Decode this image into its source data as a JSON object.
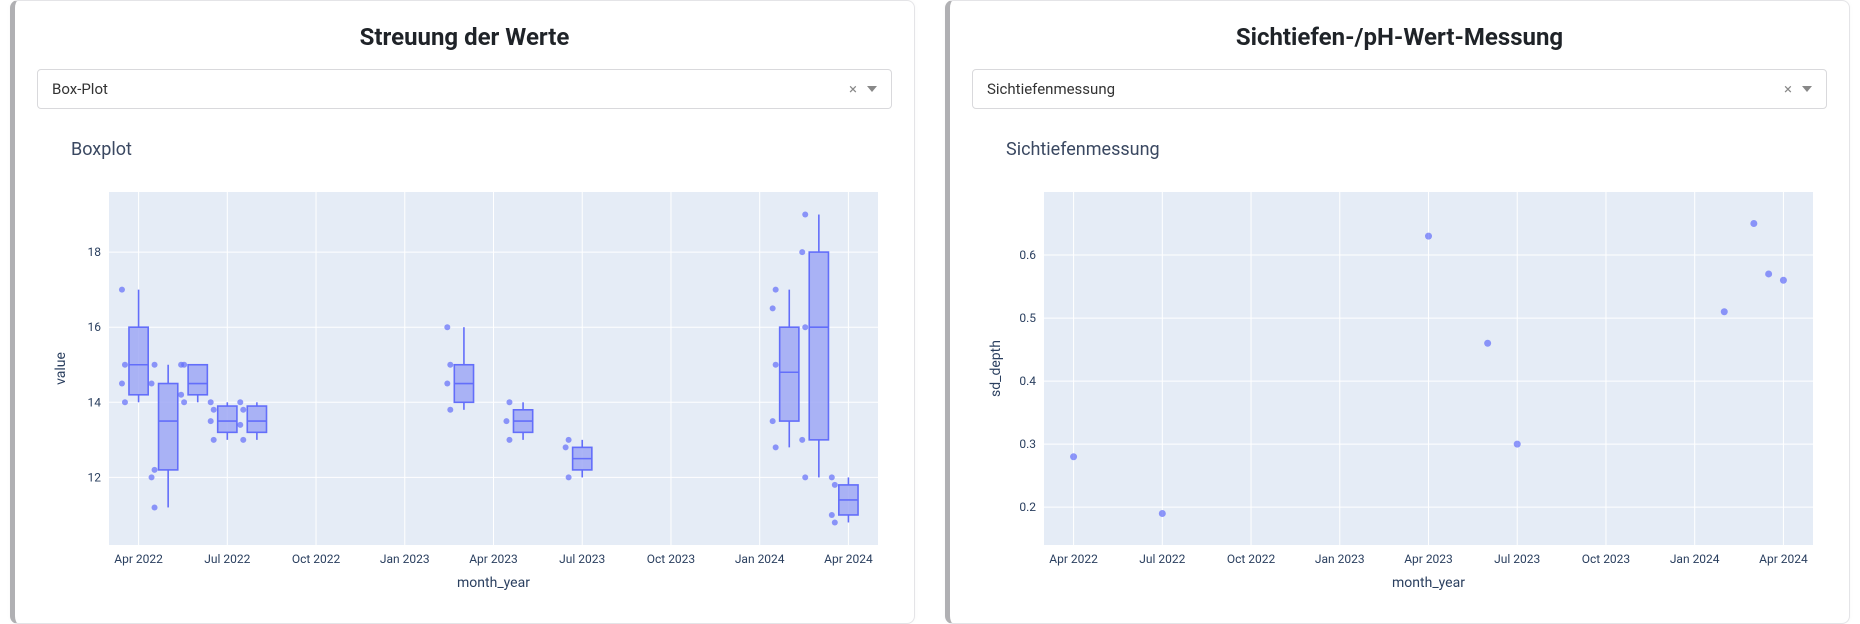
{
  "cards": [
    {
      "title": "Streuung der Werte",
      "select": "Box-Plot",
      "chart_title": "Boxplot"
    },
    {
      "title": "Sichtiefen-/pH-Wert-Messung",
      "select": "Sichtiefenmessung",
      "chart_title": "Sichtiefenmessung"
    }
  ],
  "chart_data": [
    {
      "type": "box",
      "title": "Boxplot",
      "xlabel": "month_year",
      "ylabel": "value",
      "ylim": [
        10.2,
        19.6
      ],
      "yticks": [
        12,
        14,
        16,
        18
      ],
      "x_ticks_labels": [
        "Apr 2022",
        "Jul 2022",
        "Oct 2022",
        "Jan 2023",
        "Apr 2023",
        "Jul 2023",
        "Oct 2023",
        "Jan 2024",
        "Apr 2024"
      ],
      "x_tick_positions": [
        0,
        3,
        6,
        9,
        12,
        15,
        18,
        21,
        24
      ],
      "x_range": [
        -1,
        25
      ],
      "series": [
        {
          "x": 0,
          "min": 14.0,
          "q1": 14.2,
          "median": 15.0,
          "q3": 16.0,
          "max": 17.0,
          "points": [
            14.0,
            14.5,
            15.0,
            17.0
          ]
        },
        {
          "x": 1,
          "min": 11.2,
          "q1": 12.2,
          "median": 13.5,
          "q3": 14.5,
          "max": 15.0,
          "points": [
            11.2,
            12.0,
            12.2,
            14.5,
            15.0
          ]
        },
        {
          "x": 2,
          "min": 14.0,
          "q1": 14.2,
          "median": 14.5,
          "q3": 15.0,
          "max": 15.0,
          "points": [
            14.0,
            14.2,
            15.0,
            15.0
          ]
        },
        {
          "x": 3,
          "min": 13.0,
          "q1": 13.2,
          "median": 13.5,
          "q3": 13.9,
          "max": 14.0,
          "points": [
            13.0,
            13.5,
            13.8,
            14.0
          ]
        },
        {
          "x": 4,
          "min": 13.0,
          "q1": 13.2,
          "median": 13.5,
          "q3": 13.9,
          "max": 14.0,
          "points": [
            13.0,
            13.4,
            13.8,
            14.0
          ]
        },
        {
          "x": 11,
          "min": 13.8,
          "q1": 14.0,
          "median": 14.5,
          "q3": 15.0,
          "max": 16.0,
          "points": [
            13.8,
            14.5,
            15.0,
            16.0
          ]
        },
        {
          "x": 13,
          "min": 13.0,
          "q1": 13.2,
          "median": 13.5,
          "q3": 13.8,
          "max": 14.0,
          "points": [
            13.0,
            13.5,
            14.0
          ]
        },
        {
          "x": 15,
          "min": 12.0,
          "q1": 12.2,
          "median": 12.5,
          "q3": 12.8,
          "max": 13.0,
          "points": [
            12.0,
            12.8,
            13.0
          ]
        },
        {
          "x": 22,
          "min": 12.8,
          "q1": 13.5,
          "median": 14.8,
          "q3": 16.0,
          "max": 17.0,
          "points": [
            12.8,
            13.5,
            15.0,
            16.5,
            17.0
          ]
        },
        {
          "x": 23,
          "min": 12.0,
          "q1": 13.0,
          "median": 16.0,
          "q3": 18.0,
          "max": 19.0,
          "points": [
            12.0,
            13.0,
            16.0,
            18.0,
            19.0
          ]
        },
        {
          "x": 24,
          "min": 10.8,
          "q1": 11.0,
          "median": 11.4,
          "q3": 11.8,
          "max": 12.0,
          "points": [
            10.8,
            11.0,
            11.8,
            12.0
          ]
        }
      ]
    },
    {
      "type": "scatter",
      "title": "Sichtiefenmessung",
      "xlabel": "month_year",
      "ylabel": "sd_depth",
      "ylim": [
        0.14,
        0.7
      ],
      "yticks": [
        0.2,
        0.3,
        0.4,
        0.5,
        0.6
      ],
      "x_ticks_labels": [
        "Apr 2022",
        "Jul 2022",
        "Oct 2022",
        "Jan 2023",
        "Apr 2023",
        "Jul 2023",
        "Oct 2023",
        "Jan 2024",
        "Apr 2024"
      ],
      "x_tick_positions": [
        0,
        3,
        6,
        9,
        12,
        15,
        18,
        21,
        24
      ],
      "x_range": [
        -1,
        25
      ],
      "points": [
        {
          "x": 0,
          "y": 0.28
        },
        {
          "x": 3,
          "y": 0.19
        },
        {
          "x": 12,
          "y": 0.63
        },
        {
          "x": 14,
          "y": 0.46
        },
        {
          "x": 15,
          "y": 0.3
        },
        {
          "x": 22,
          "y": 0.51
        },
        {
          "x": 23,
          "y": 0.65
        },
        {
          "x": 23.5,
          "y": 0.57
        },
        {
          "x": 24,
          "y": 0.56
        }
      ]
    }
  ]
}
